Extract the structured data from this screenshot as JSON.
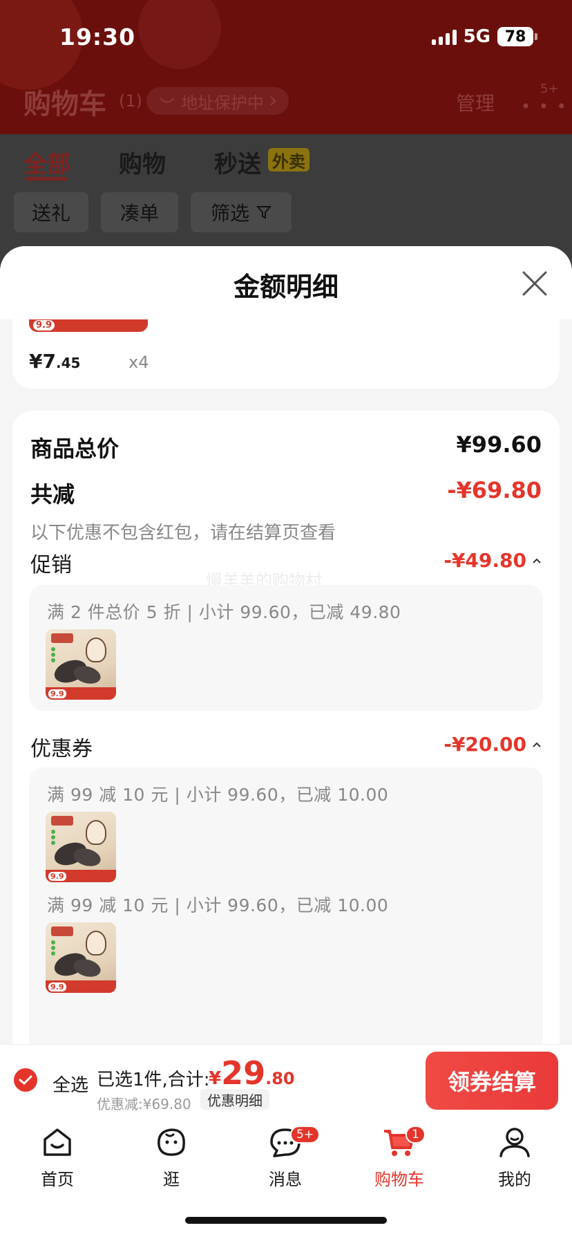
{
  "status_bar": {
    "time": "19:30",
    "network": "5G",
    "battery": "78"
  },
  "cart_header": {
    "title": "购物车",
    "count": "(1)",
    "address_protect": "地址保护中",
    "manage": "管理",
    "more_badge": "5+"
  },
  "tabs": [
    {
      "label": "全部"
    },
    {
      "label": "购物"
    },
    {
      "label": "秒送"
    }
  ],
  "waimai_badge": "外卖",
  "chips": [
    {
      "label": "送礼"
    },
    {
      "label": "凑单"
    },
    {
      "label": "筛选"
    }
  ],
  "sheet": {
    "title": "金额明细",
    "top_item": {
      "badge": "9.9",
      "price_int": "¥7",
      "price_dec": ".45",
      "qty": "x4"
    },
    "total_label": "商品总价",
    "total_value": "¥99.60",
    "reduce_label": "共减",
    "reduce_value": "-¥69.80",
    "reduce_note": "以下优惠不包含红包，请在结算页查看",
    "watermark": "慢羊羊的购物村",
    "promo": {
      "label": "促销",
      "value": "-¥49.80",
      "line": "满 2 件总价 5 折 | 小计 99.60，已减 49.80"
    },
    "coupon": {
      "label": "优惠券",
      "value": "-¥20.00",
      "lines": [
        "满 99 减 10 元 | 小计 99.60，已减 10.00",
        "满 99 减 10 元 | 小计 99.60，已减 10.00"
      ]
    }
  },
  "checkout": {
    "select_all": "全选",
    "selected_text": "已选1件,合计:",
    "currency": "¥",
    "total_int": "29",
    "total_dec": ".80",
    "discount_text": "优惠减:¥69.80",
    "detail_button": "优惠明细",
    "checkout_button": "领券结算"
  },
  "tabbar": {
    "items": [
      {
        "label": "首页",
        "icon": "home-icon"
      },
      {
        "label": "逛",
        "icon": "explore-icon"
      },
      {
        "label": "消息",
        "icon": "message-icon",
        "badge": "5+"
      },
      {
        "label": "购物车",
        "icon": "cart-icon",
        "badge": "1",
        "active": true
      },
      {
        "label": "我的",
        "icon": "profile-icon"
      }
    ]
  },
  "colors": {
    "accent": "#e4352b",
    "header_dim": "#6b0f0c"
  }
}
